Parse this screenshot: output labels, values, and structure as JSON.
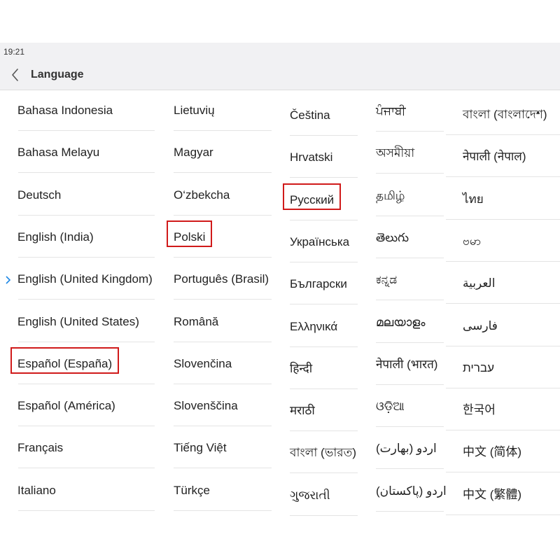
{
  "status_bar": {
    "time": "19:21"
  },
  "header": {
    "title": "Language",
    "back_icon": "chevron-left-icon"
  },
  "accent_color": "#1e88e5",
  "highlight_color": "#d01a1a",
  "selected_language": "English (United Kingdom)",
  "columns": [
    [
      "Bahasa Indonesia",
      "Bahasa Melayu",
      "Deutsch",
      "English (India)",
      "English (United Kingdom)",
      "English (United States)",
      "Español (España)",
      "Español (América)",
      "Français",
      "Italiano"
    ],
    [
      "Lietuvių",
      "Magyar",
      "O‘zbekcha",
      "Polski",
      "Português (Brasil)",
      "Română",
      "Slovenčina",
      "Slovenščina",
      "Tiếng Việt",
      "Türkçe"
    ],
    [
      "Čeština",
      "Hrvatski",
      "Русский",
      "Українська",
      "Български",
      "Ελληνικά",
      "हिन्दी",
      "मराठी",
      "বাংলা (ভারত)",
      "ગુજરાતી"
    ],
    [
      "ਪੰਜਾਬੀ",
      "অসমীয়া",
      "தமிழ்",
      "తెలుగు",
      "ಕನ್ನಡ",
      "മലയാളം",
      "नेपाली (भारत)",
      "ଓଡ଼ିଆ",
      "اردو (بھارت)",
      "اردو (پاکستان)"
    ],
    [
      "বাংলা (বাংলাদেশ)",
      "नेपाली (नेपाल)",
      "ไทย",
      "ဗမာ",
      "العربية",
      "فارسی",
      "עברית",
      "한국어",
      "中文 (简体)",
      "中文 (繁體)"
    ]
  ],
  "highlighted_items": [
    "Español (España)",
    "Polski",
    "Русский"
  ]
}
